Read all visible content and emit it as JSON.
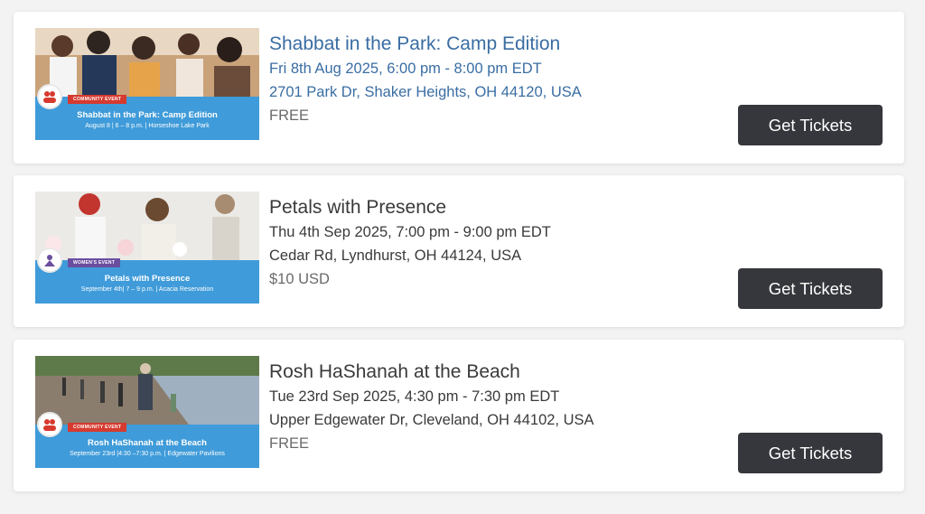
{
  "events": [
    {
      "title": "Shabbat in the Park: Camp Edition",
      "title_is_link": true,
      "datetime": "Fri 8th Aug 2025, 6:00 pm - 8:00 pm EDT",
      "address": "2701 Park Dr, Shaker Heights, OH 44120, USA",
      "price": "FREE",
      "button_label": "Get Tickets",
      "image": {
        "tag": "COMMUNITY EVENT",
        "banner_title": "Shabbat in the Park: Camp Edition",
        "banner_sub": "August 8 | 6 – 8 p.m. | Horseshoe Lake Park",
        "logo_icon": "community-logo-icon"
      }
    },
    {
      "title": "Petals with Presence",
      "title_is_link": false,
      "datetime": "Thu 4th Sep 2025, 7:00 pm - 9:00 pm EDT",
      "address": "Cedar Rd, Lyndhurst, OH 44124, USA",
      "price": "$10 USD",
      "button_label": "Get Tickets",
      "image": {
        "tag": "WOMEN'S EVENT",
        "banner_title": "Petals with Presence",
        "banner_sub": "September 4th| 7 – 9 p.m. | Acacia Reservation",
        "logo_icon": "womens-logo-icon"
      }
    },
    {
      "title": "Rosh HaShanah at the Beach",
      "title_is_link": false,
      "datetime": "Tue 23rd Sep 2025, 4:30 pm - 7:30 pm EDT",
      "address": "Upper Edgewater Dr, Cleveland, OH 44102, USA",
      "price": "FREE",
      "button_label": "Get Tickets",
      "image": {
        "tag": "COMMUNITY EVENT",
        "banner_title": "Rosh HaShanah at the Beach",
        "banner_sub": "September 23rd |4:30 –7:30 p.m. | Edgewater Pavilions",
        "logo_icon": "community-logo-icon"
      }
    }
  ],
  "colors": {
    "link": "#3a6da3",
    "button_bg": "#36373c",
    "banner_bg": "#3f9bd9",
    "community_tag": "#d63a2f",
    "womens_tag": "#6a4ea0"
  }
}
